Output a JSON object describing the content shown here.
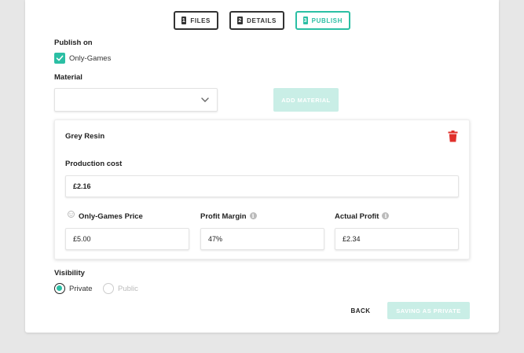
{
  "steps": [
    {
      "num": "1",
      "label": "FILES"
    },
    {
      "num": "2",
      "label": "DETAILS"
    },
    {
      "num": "3",
      "label": "PUBLISH"
    }
  ],
  "publish": {
    "heading": "Publish on",
    "option_label": "Only-Games",
    "checked": true
  },
  "material": {
    "heading": "Material",
    "select_value": "",
    "add_button": "ADD MATERIAL"
  },
  "panel": {
    "title": "Grey Resin",
    "production_cost_label": "Production cost",
    "production_cost_value": "£2.16",
    "price_label": "Only-Games Price",
    "price_value": "£5.00",
    "margin_label": "Profit Margin",
    "margin_value": "47%",
    "profit_label": "Actual Profit",
    "profit_value": "£2.34"
  },
  "visibility": {
    "heading": "Visibility",
    "options": [
      "Private",
      "Public"
    ],
    "selected": "Private"
  },
  "actions": {
    "back": "BACK",
    "save": "SAVING AS PRIVATE"
  },
  "colors": {
    "accent": "#2bbfa4",
    "accent_disabled": "#c9eee6",
    "delete": "#e0302b"
  },
  "icons": {
    "delete": "trash-icon",
    "info": "info-icon",
    "dropdown": "chevron-down-icon",
    "check": "check-icon",
    "coin": "coin-icon"
  }
}
